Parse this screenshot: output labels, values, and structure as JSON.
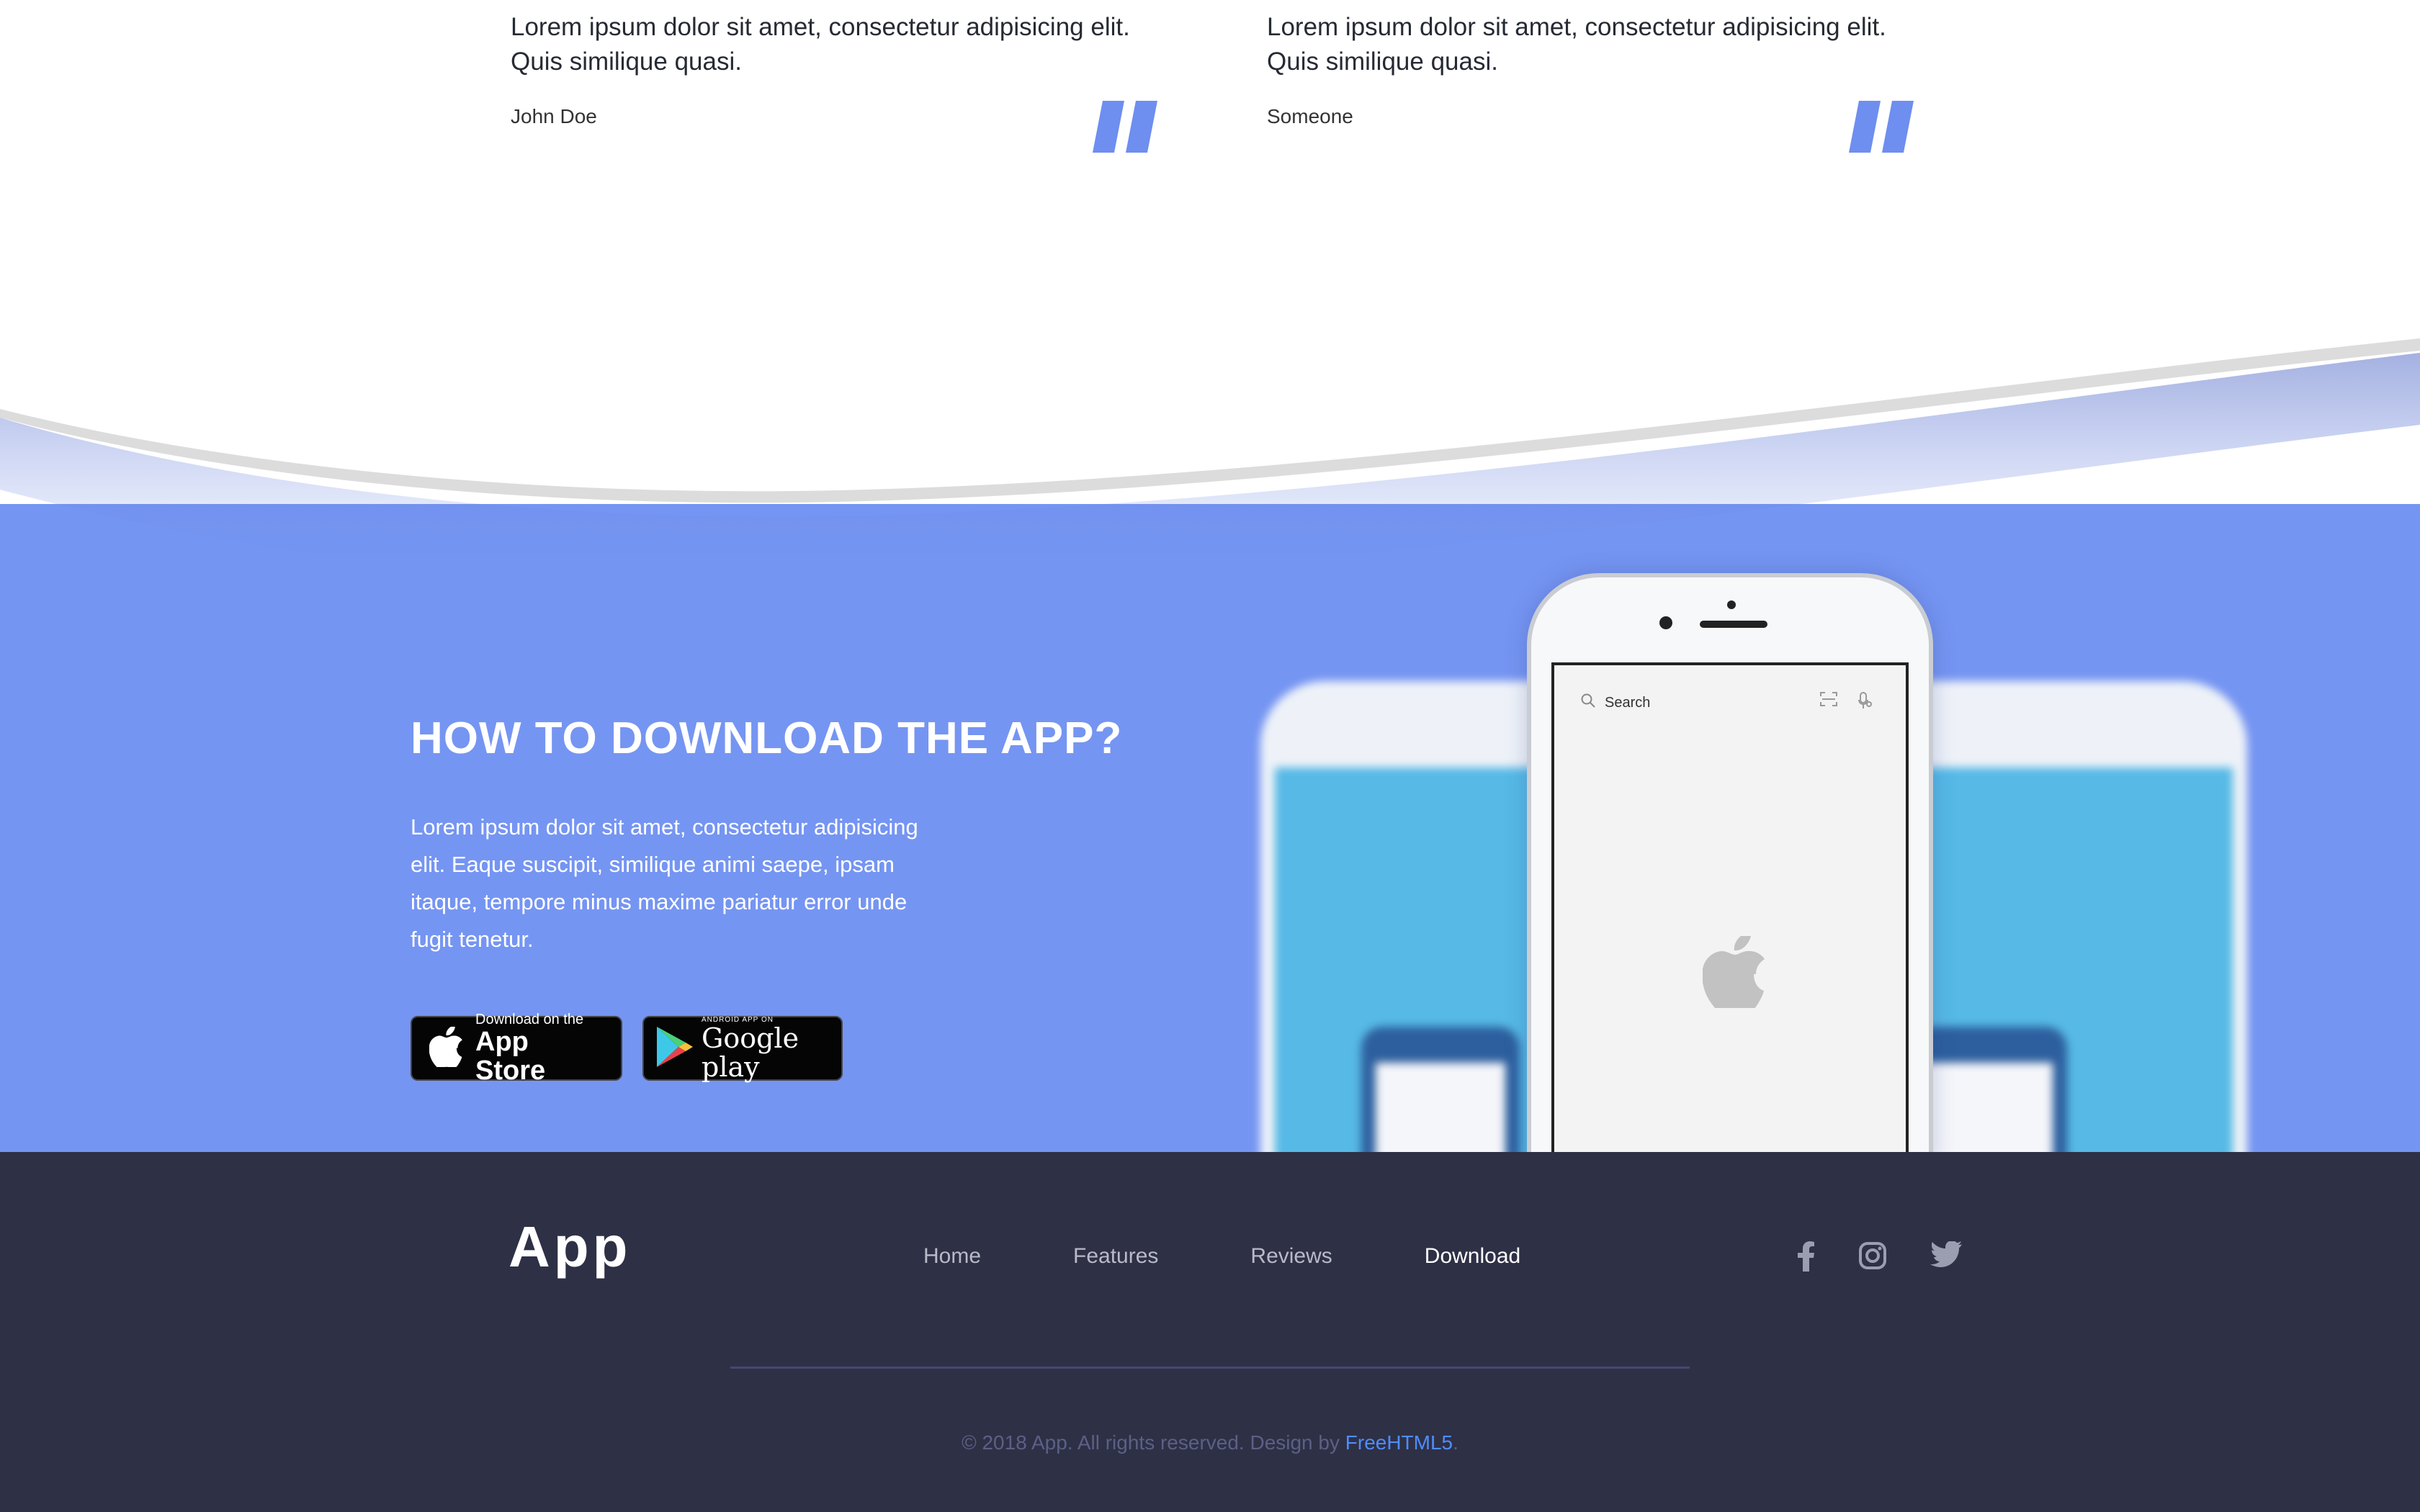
{
  "testimonials": [
    {
      "quote": "Lorem ipsum dolor sit amet, consectetur adipisicing elit. Quis similique quasi.",
      "author": "John Doe",
      "icon": "closing-quote-icon"
    },
    {
      "quote": "Lorem ipsum dolor sit amet, consectetur adipisicing elit. Quis similique quasi.",
      "author": "Someone",
      "icon": "closing-quote-icon"
    }
  ],
  "download": {
    "title": "HOW TO DOWNLOAD THE APP?",
    "description": "Lorem ipsum dolor sit amet, consectetur adipisicing elit. Eaque suscipit, similique animi saepe, ipsam itaque, tempore minus maxime pariatur error unde fugit tenetur.",
    "app_store": {
      "small": "Download on the",
      "big": "App Store",
      "icon": "apple-icon"
    },
    "google_play": {
      "small": "ANDROID APP ON",
      "big": "Google play",
      "icon": "google-play-icon"
    },
    "phone_screen": {
      "search_label": "Search",
      "icons": [
        "search-icon",
        "scan-icon",
        "mic-icon",
        "apple-logo-icon"
      ]
    }
  },
  "footer": {
    "logo": "App",
    "nav": [
      {
        "label": "Home",
        "active": false
      },
      {
        "label": "Features",
        "active": false
      },
      {
        "label": "Reviews",
        "active": false
      },
      {
        "label": "Download",
        "active": true
      }
    ],
    "social": [
      "facebook-icon",
      "instagram-icon",
      "twitter-icon"
    ],
    "copyright_text": "© 2018 App. All rights reserved. Design by ",
    "copyright_link": "FreeHTML5",
    "copyright_end": "."
  },
  "colors": {
    "accent": "#7595f2",
    "quote_icon": "#6e8ef0",
    "footer_bg": "#2e3046",
    "link": "#4f8dfb"
  }
}
